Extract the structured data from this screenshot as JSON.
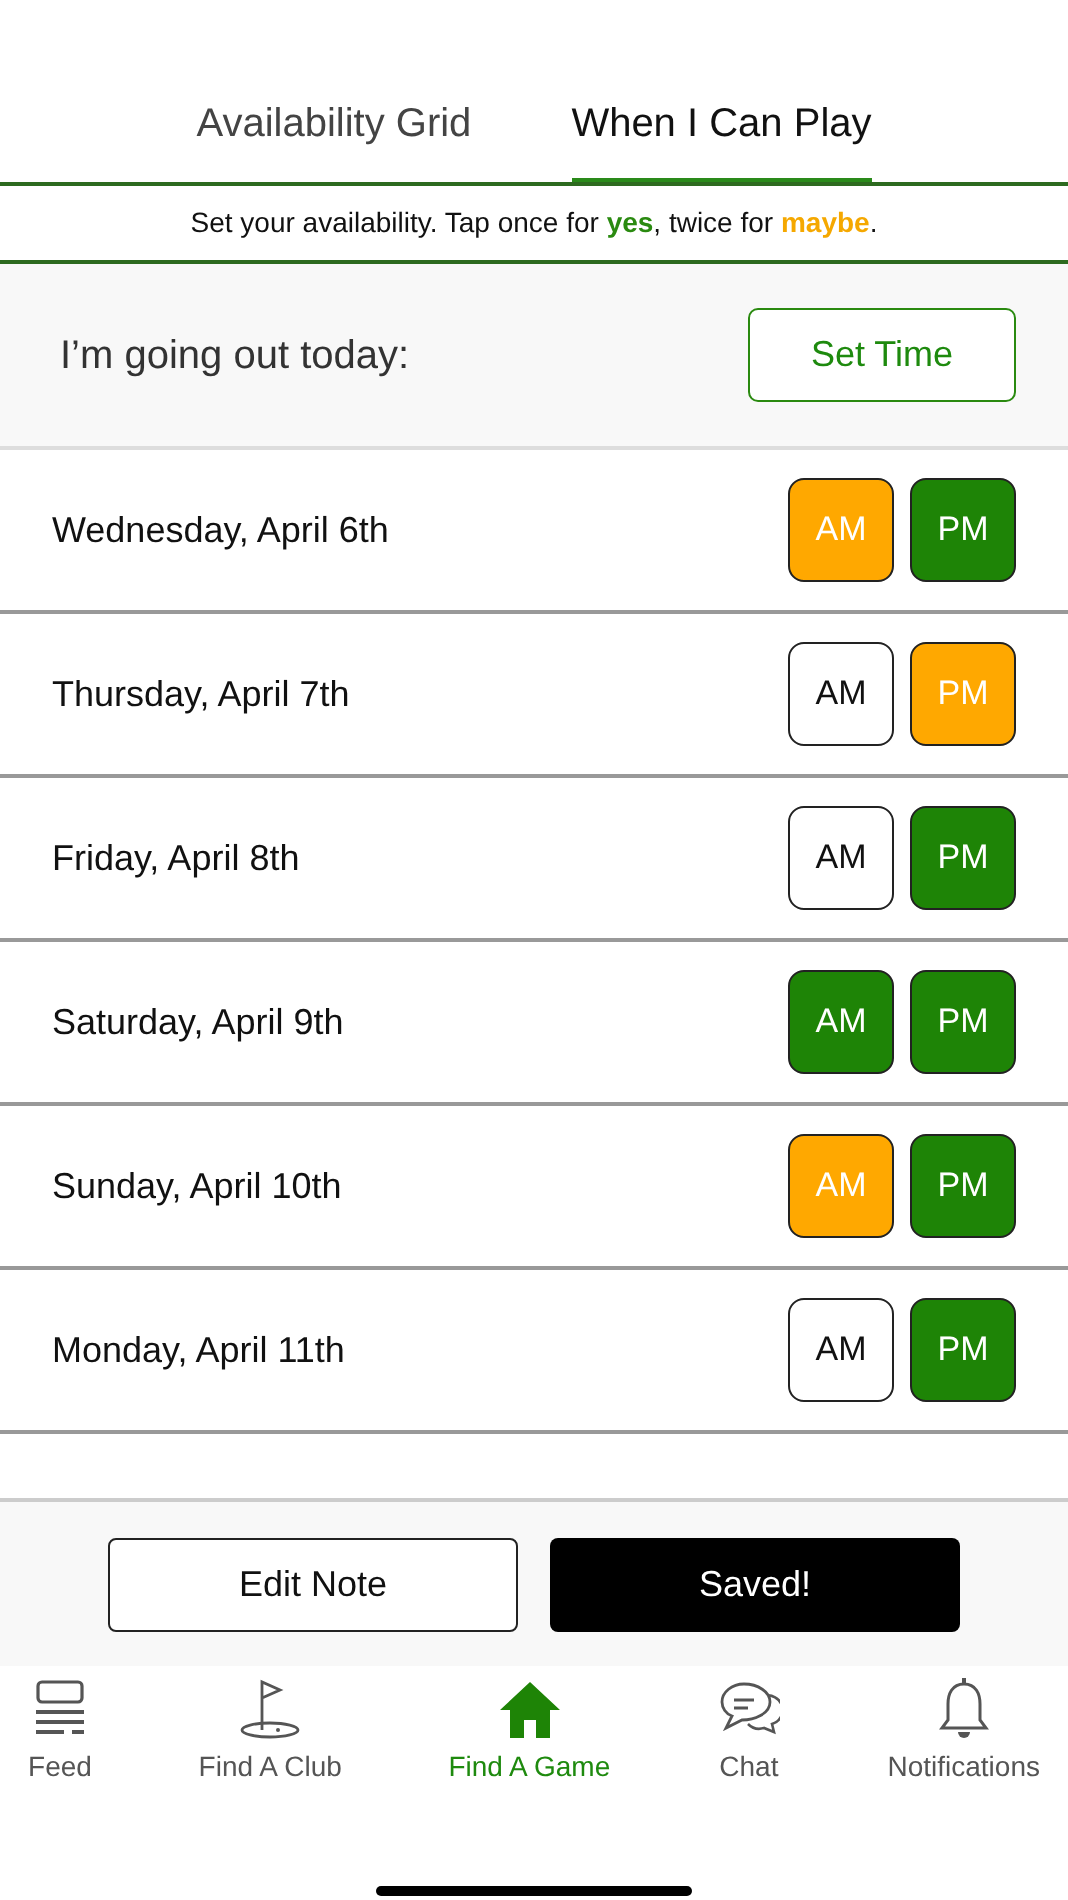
{
  "tabs": [
    {
      "label": "Availability Grid",
      "selected": false
    },
    {
      "label": "When I Can Play",
      "selected": true
    }
  ],
  "hint": "Set your availability. Tap once for **yes**, twice for *maybe*.",
  "going_out": {
    "label": "I’m going out today:",
    "button": "Set Time"
  },
  "days": [
    {
      "date": "Wednesday, April 6th",
      "slots": [
        {
          "label": "AM",
          "kind": "maybe"
        },
        {
          "label": "PM",
          "kind": "yes"
        }
      ]
    },
    {
      "date": "Thursday, April 7th",
      "slots": [
        {
          "label": "AM",
          "kind": "none"
        },
        {
          "label": "PM",
          "kind": "maybe"
        }
      ]
    },
    {
      "date": "Friday, April 8th",
      "slots": [
        {
          "label": "AM",
          "kind": "none"
        },
        {
          "label": "PM",
          "kind": "yes"
        }
      ]
    },
    {
      "date": "Saturday, April 9th",
      "slots": [
        {
          "label": "AM",
          "kind": "yes"
        },
        {
          "label": "PM",
          "kind": "yes"
        }
      ]
    },
    {
      "date": "Sunday, April 10th",
      "slots": [
        {
          "label": "AM",
          "kind": "maybe"
        },
        {
          "label": "PM",
          "kind": "yes"
        }
      ]
    },
    {
      "date": "Monday, April 11th",
      "slots": [
        {
          "label": "AM",
          "kind": "none"
        },
        {
          "label": "PM",
          "kind": "yes"
        }
      ]
    }
  ],
  "actions": [
    {
      "label": "Edit Note",
      "kind": "outline"
    },
    {
      "label": "Saved!",
      "kind": "solid"
    }
  ],
  "nav": [
    {
      "label": "Feed",
      "selected": false
    },
    {
      "label": "Find A Club",
      "selected": false
    },
    {
      "label": "Find A Game",
      "selected": true
    },
    {
      "label": "Chat",
      "selected": false
    },
    {
      "label": "Notifications",
      "selected": false
    }
  ]
}
